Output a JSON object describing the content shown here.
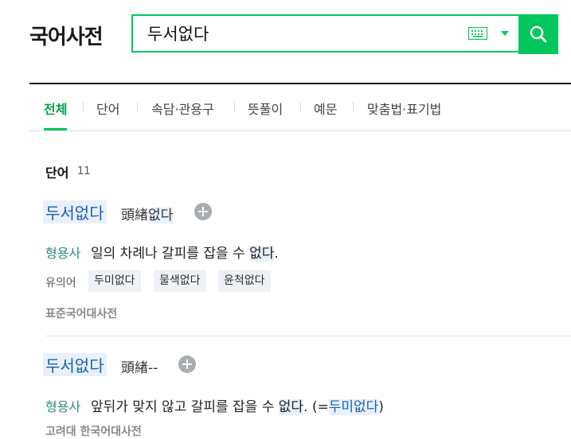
{
  "header": {
    "logo": "국어사전",
    "search_value": "두서없다"
  },
  "tabs": [
    "전체",
    "단어",
    "속담·관용구",
    "뜻풀이",
    "예문",
    "맞춤법·표기법"
  ],
  "section": {
    "title": "단어",
    "count": "11"
  },
  "entries": [
    {
      "word": "두서없다",
      "hanja_main": "頭緖",
      "hanja_suffix": "없다",
      "pos": "형용사",
      "def_pre": "일의 차례나 갈피를 잡을 수 ",
      "def_hl": "없다",
      "def_post": ".",
      "syn_label": "유의어",
      "synonyms": [
        "두미없다",
        "물색없다",
        "윤척없다"
      ],
      "source": "표준국어대사전"
    },
    {
      "word": "두서없다",
      "hanja_main": "頭緖--",
      "pos": "형용사",
      "def_pre": "앞뒤가 맞지 않고 갈피를 잡을 수 ",
      "def_hl": "없다",
      "def_mid": ". (=",
      "def_link": "두미없다",
      "def_post": ")",
      "source": "고려대 한국어대사전"
    }
  ],
  "colors": {
    "accent": "#03c75a",
    "active_tab": "#00a34a",
    "link": "#1a5fb4",
    "highlight": "#e8f1fb"
  }
}
